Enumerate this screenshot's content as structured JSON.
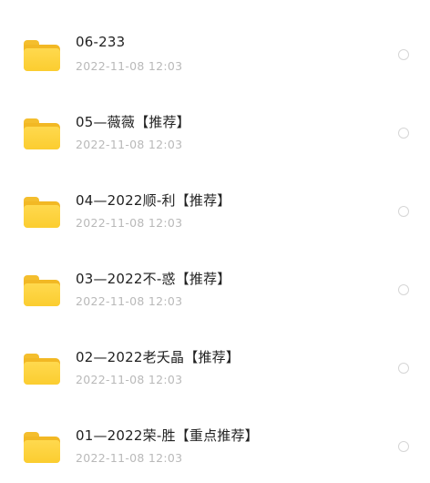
{
  "files": [
    {
      "name": "06-233",
      "time": "2022-11-08 12:03",
      "icon": "folder-icon",
      "checked": false
    },
    {
      "name": "05—薇薇【推荐】",
      "time": "2022-11-08 12:03",
      "icon": "folder-icon",
      "checked": false
    },
    {
      "name": "04—2022顺-利【推荐】",
      "time": "2022-11-08 12:03",
      "icon": "folder-icon",
      "checked": false
    },
    {
      "name": "03—2022不-惑【推荐】",
      "time": "2022-11-08 12:03",
      "icon": "folder-icon",
      "checked": false
    },
    {
      "name": "02—2022老夭晶【推荐】",
      "time": "2022-11-08 12:03",
      "icon": "folder-icon",
      "checked": false
    },
    {
      "name": "01—2022荣-胜【重点推荐】",
      "time": "2022-11-08 12:03",
      "icon": "folder-icon",
      "checked": false
    }
  ],
  "colors": {
    "folder": "#fbcd30",
    "title": "#222222",
    "timestamp": "#b9b9b9",
    "radio_border": "#d6d6d6"
  }
}
